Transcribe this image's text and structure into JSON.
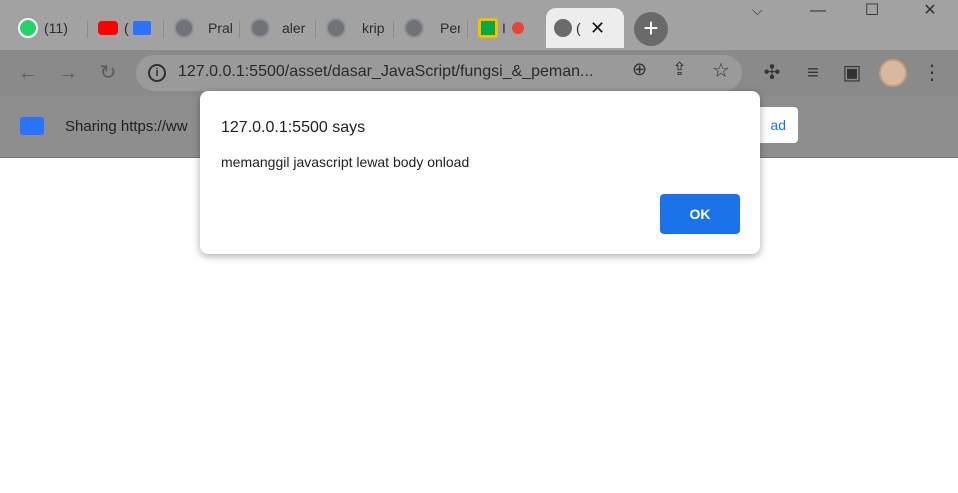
{
  "browser": {
    "tabs": [
      {
        "label": "(11)",
        "icon": "whatsapp-icon",
        "color": "#25d366"
      },
      {
        "label": "(",
        "icon": "youtube-icon",
        "color": "#ff0000"
      },
      {
        "label": "Prak",
        "icon": "globe-icon"
      },
      {
        "label": "aler",
        "icon": "globe-icon"
      },
      {
        "label": "krip",
        "icon": "globe-icon"
      },
      {
        "label": "Pem",
        "icon": "globe-icon"
      },
      {
        "label": "I",
        "icon": "meet-icon"
      },
      {
        "label": "(",
        "icon": "globe-icon",
        "active": true
      }
    ],
    "new_tab_label": "+",
    "window_controls": {
      "minimize": "—",
      "maximize": "☐",
      "close": "✕"
    },
    "url": "127.0.0.1:5500/asset/dasar_JavaScript/fungsi_&_peman...",
    "sharing_text": "Sharing https://ww",
    "sharing_button_label": "ad"
  },
  "dialog": {
    "title": "127.0.0.1:5500 says",
    "message": "memanggil javascript lewat body onload",
    "ok_label": "OK"
  },
  "colors": {
    "accent": "#1a73e8",
    "overlay": "#8a8a8a"
  }
}
